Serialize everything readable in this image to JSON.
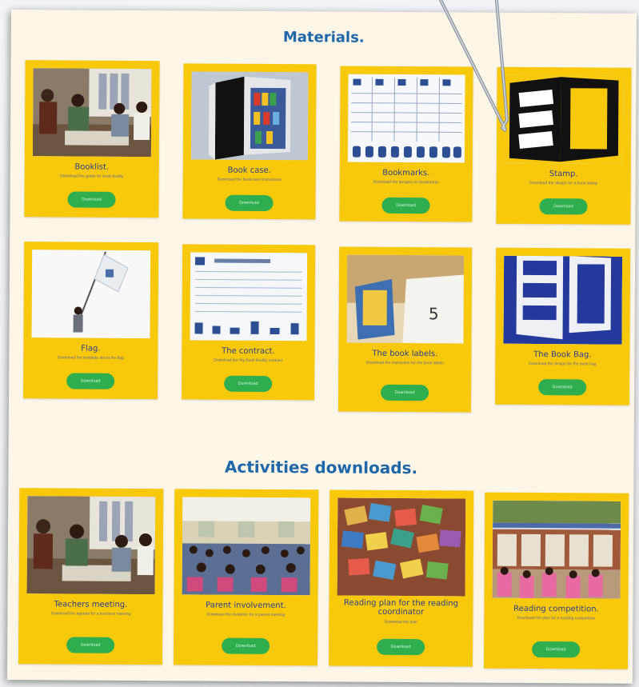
{
  "sections": {
    "materials_title": "Materials.",
    "activities_title": "Activities downloads."
  },
  "materials": [
    {
      "title": "Booklist.",
      "desc": "Download the guide for book buddy",
      "button": "Download",
      "thumb": "classroom-photo"
    },
    {
      "title": "Book case.",
      "desc": "Download the bookcase instructions",
      "button": "Download",
      "thumb": "bookcase-illustration"
    },
    {
      "title": "Bookmarks.",
      "desc": "Download the designs on bookmarks",
      "button": "Download",
      "thumb": "bookmarks-sheet"
    },
    {
      "title": "Stamp.",
      "desc": "Download the design for a book stamp",
      "button": "Download",
      "thumb": "my-book-buddy-logo"
    },
    {
      "title": "Flag.",
      "desc": "Download the template about the flag",
      "button": "Download",
      "thumb": "flag-photo"
    },
    {
      "title": "The contract.",
      "desc": "Download the My Book Buddy contract",
      "button": "Download",
      "thumb": "contract-document"
    },
    {
      "title": "The book labels.",
      "desc": "Download the instruction for the book labels",
      "button": "Download",
      "thumb": "book-labels-photo"
    },
    {
      "title": "The Book Bag.",
      "desc": "Download the design for the book bag",
      "button": "Download",
      "thumb": "book-bag-logo"
    }
  ],
  "activities": [
    {
      "title": "Teachers meeting.",
      "desc": "Download the agenda for a teachers meeting",
      "button": "Download",
      "thumb": "classroom-photo"
    },
    {
      "title": "Parent involvement.",
      "desc": "Download the invitation for a parent meeting",
      "button": "Download",
      "thumb": "parent-meeting-photo"
    },
    {
      "title": "Reading plan for the reading coordinator",
      "desc": "Download the plan",
      "button": "Download",
      "thumb": "books-pile-photo"
    },
    {
      "title": "Reading competition.",
      "desc": "Download the plan for a reading competition",
      "button": "Download",
      "thumb": "reading-competition-photo"
    }
  ],
  "colors": {
    "card": "#f8c80a",
    "button": "#2eae4e",
    "heading": "#1f67a9",
    "background": "#fbf6e8"
  }
}
